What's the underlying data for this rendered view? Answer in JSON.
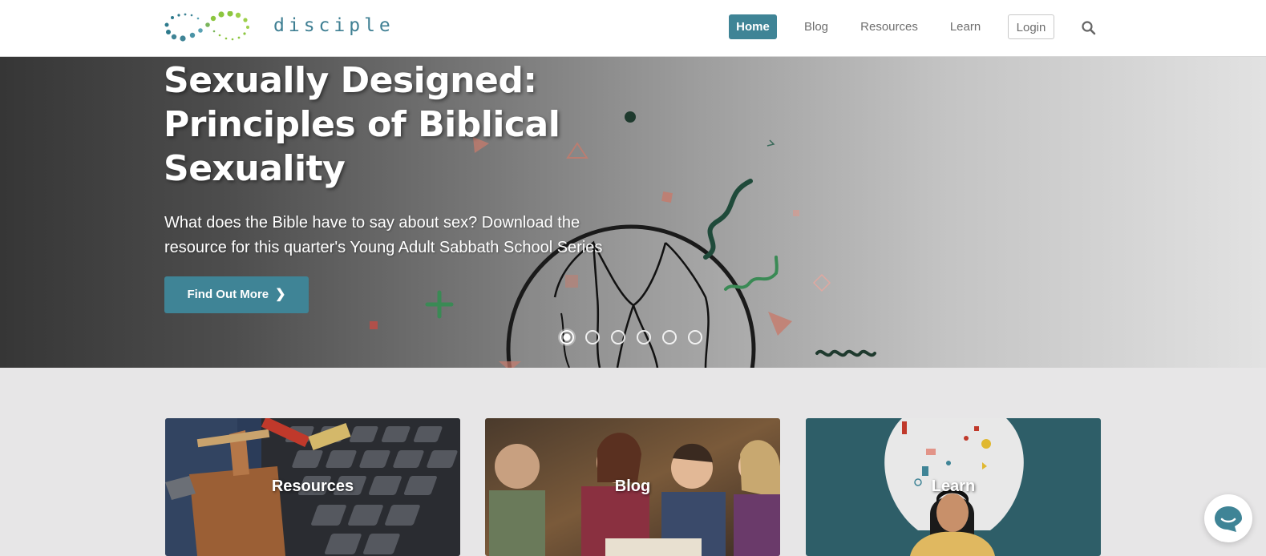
{
  "header": {
    "logo_text": "disciple",
    "nav": {
      "home": "Home",
      "blog": "Blog",
      "resources": "Resources",
      "learn": "Learn",
      "login": "Login"
    },
    "search_icon": "search-icon"
  },
  "hero": {
    "title": "Sexually Designed: Principles of Biblical Sexuality",
    "subtitle": "What does the Bible have to say about sex? Download the resource for this quarter's Young Adult Sabbath School Series",
    "button_label": "Find Out More",
    "slide_count": 6,
    "active_slide": 1
  },
  "cards": [
    {
      "label": "Resources"
    },
    {
      "label": "Blog"
    },
    {
      "label": "Learn"
    }
  ],
  "chat": {
    "icon": "chat-bubble-icon"
  },
  "colors": {
    "accent": "#3f8496",
    "logo_teal": "#3f7f93",
    "logo_green": "#8cc63f"
  }
}
